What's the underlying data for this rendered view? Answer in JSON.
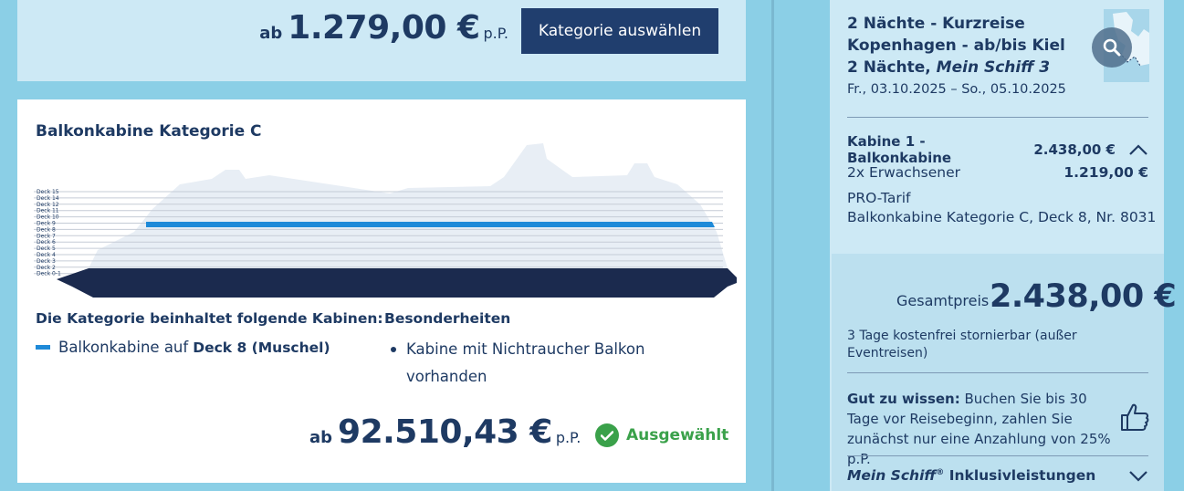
{
  "top_offer": {
    "ab": "ab",
    "price": "1.279,00 €",
    "pp": "p.P.",
    "button": "Kategorie auswählen"
  },
  "cabin": {
    "title": "Balkonkabine Kategorie C",
    "decks": [
      "Deck 15",
      "Deck 14",
      "Deck 12",
      "Deck 11",
      "Deck 10",
      "Deck 9",
      "Deck 8",
      "Deck 7",
      "Deck 6",
      "Deck 5",
      "Deck 4",
      "Deck 3",
      "Deck 2",
      "Deck 0-1"
    ],
    "highlight_deck": "Deck 8",
    "highlight_color": "#1f8ad8",
    "includes_heading": "Die Kategorie beinhaltet folgende Kabinen:",
    "cabin_type": "Balkonkabine auf",
    "cabin_deck": "Deck 8 (Muschel)",
    "features_heading": "Besonderheiten",
    "features": [
      "Kabine mit Nichtraucher Balkon vorhanden"
    ],
    "ab": "ab",
    "price": "92.510,43 €",
    "pp": "p.P.",
    "selected_label": "Ausgewählt"
  },
  "sidebar": {
    "trip_line1": "2 Nächte - Kurzreise",
    "trip_line2": "Kopenhagen - ab/bis Kiel",
    "trip_line3": "2 Nächte,",
    "ship": "Mein Schiff 3",
    "dates": "Fr., 03.10.2025 – So., 05.10.2025",
    "cabin_label": "Kabine 1 - Balkonkabine",
    "cabin_price": "2.438,00 €",
    "adults": "2x Erwachsener",
    "adults_price": "1.219,00 €",
    "tarif": "PRO-Tarif",
    "cabin_detail": "Balkonkabine Kategorie C, Deck 8, Nr. 8031",
    "total_label": "Gesamtpreis",
    "total": "2.438,00 €",
    "storno": "3 Tage kostenfrei stornierbar (außer Eventreisen)",
    "good_to_know_label": "Gut zu wissen:",
    "good_to_know_text": "Buchen Sie bis 30 Tage vor Reisebeginn, zahlen Sie zunächst nur eine Anzahlung von 25% p.P.",
    "inkl_brand": "Mein Schiff",
    "inkl_reg": "®",
    "inkl_text": "Inklusivleistungen"
  }
}
